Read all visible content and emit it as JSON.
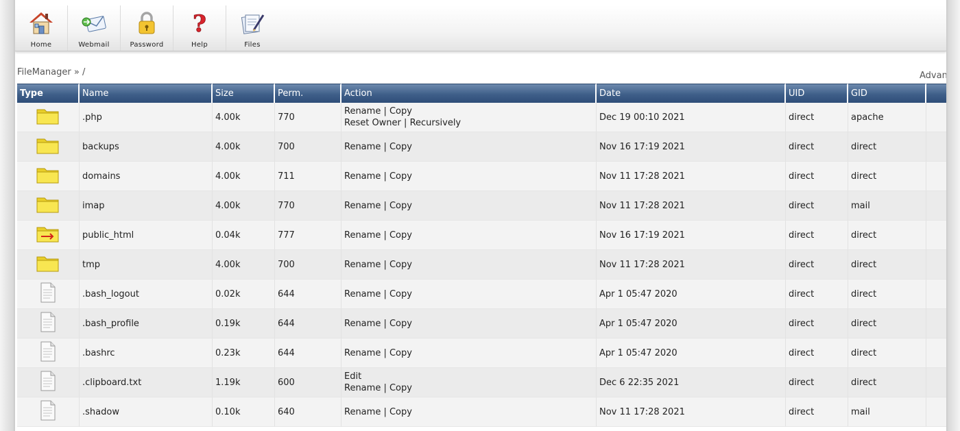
{
  "toolbar": {
    "items": [
      {
        "label": "Home",
        "icon": "home-icon"
      },
      {
        "label": "Webmail",
        "icon": "webmail-icon"
      },
      {
        "label": "Password",
        "icon": "padlock-icon"
      },
      {
        "label": "Help",
        "icon": "help-icon"
      },
      {
        "label": "Files",
        "icon": "files-icon"
      }
    ]
  },
  "breadcrumb": "FileManager » /",
  "advanced_label": "Advan",
  "table": {
    "headers": {
      "type": "Type",
      "name": "Name",
      "size": "Size",
      "perm": "Perm.",
      "action": "Action",
      "date": "Date",
      "uid": "UID",
      "gid": "GID"
    },
    "rows": [
      {
        "kind": "folder",
        "name": ".php",
        "size": "4.00k",
        "perm": "770",
        "actions": [
          [
            "Rename",
            "Copy"
          ],
          [
            "Reset Owner",
            "Recursively"
          ]
        ],
        "date": "Dec 19 00:10 2021",
        "uid": "direct",
        "gid": "apache"
      },
      {
        "kind": "folder",
        "name": "backups",
        "size": "4.00k",
        "perm": "700",
        "actions": [
          [
            "Rename",
            "Copy"
          ]
        ],
        "date": "Nov 16 17:19 2021",
        "uid": "direct",
        "gid": "direct"
      },
      {
        "kind": "folder",
        "name": "domains",
        "size": "4.00k",
        "perm": "711",
        "actions": [
          [
            "Rename",
            "Copy"
          ]
        ],
        "date": "Nov 11 17:28 2021",
        "uid": "direct",
        "gid": "direct"
      },
      {
        "kind": "folder",
        "name": "imap",
        "size": "4.00k",
        "perm": "770",
        "actions": [
          [
            "Rename",
            "Copy"
          ]
        ],
        "date": "Nov 11 17:28 2021",
        "uid": "direct",
        "gid": "mail"
      },
      {
        "kind": "link-folder",
        "name": "public_html",
        "size": "0.04k",
        "perm": "777",
        "actions": [
          [
            "Rename",
            "Copy"
          ]
        ],
        "date": "Nov 16 17:19 2021",
        "uid": "direct",
        "gid": "direct"
      },
      {
        "kind": "folder",
        "name": "tmp",
        "size": "4.00k",
        "perm": "700",
        "actions": [
          [
            "Rename",
            "Copy"
          ]
        ],
        "date": "Nov 11 17:28 2021",
        "uid": "direct",
        "gid": "direct"
      },
      {
        "kind": "file",
        "name": ".bash_logout",
        "size": "0.02k",
        "perm": "644",
        "actions": [
          [
            "Rename",
            "Copy"
          ]
        ],
        "date": "Apr 1 05:47 2020",
        "uid": "direct",
        "gid": "direct"
      },
      {
        "kind": "file",
        "name": ".bash_profile",
        "size": "0.19k",
        "perm": "644",
        "actions": [
          [
            "Rename",
            "Copy"
          ]
        ],
        "date": "Apr 1 05:47 2020",
        "uid": "direct",
        "gid": "direct"
      },
      {
        "kind": "file",
        "name": ".bashrc",
        "size": "0.23k",
        "perm": "644",
        "actions": [
          [
            "Rename",
            "Copy"
          ]
        ],
        "date": "Apr 1 05:47 2020",
        "uid": "direct",
        "gid": "direct"
      },
      {
        "kind": "file",
        "name": ".clipboard.txt",
        "size": "1.19k",
        "perm": "600",
        "actions": [
          [
            "Edit"
          ],
          [
            "Rename",
            "Copy"
          ]
        ],
        "date": "Dec 6 22:35 2021",
        "uid": "direct",
        "gid": "direct"
      },
      {
        "kind": "file",
        "name": ".shadow",
        "size": "0.10k",
        "perm": "640",
        "actions": [
          [
            "Rename",
            "Copy"
          ]
        ],
        "date": "Nov 11 17:28 2021",
        "uid": "direct",
        "gid": "mail"
      }
    ]
  }
}
